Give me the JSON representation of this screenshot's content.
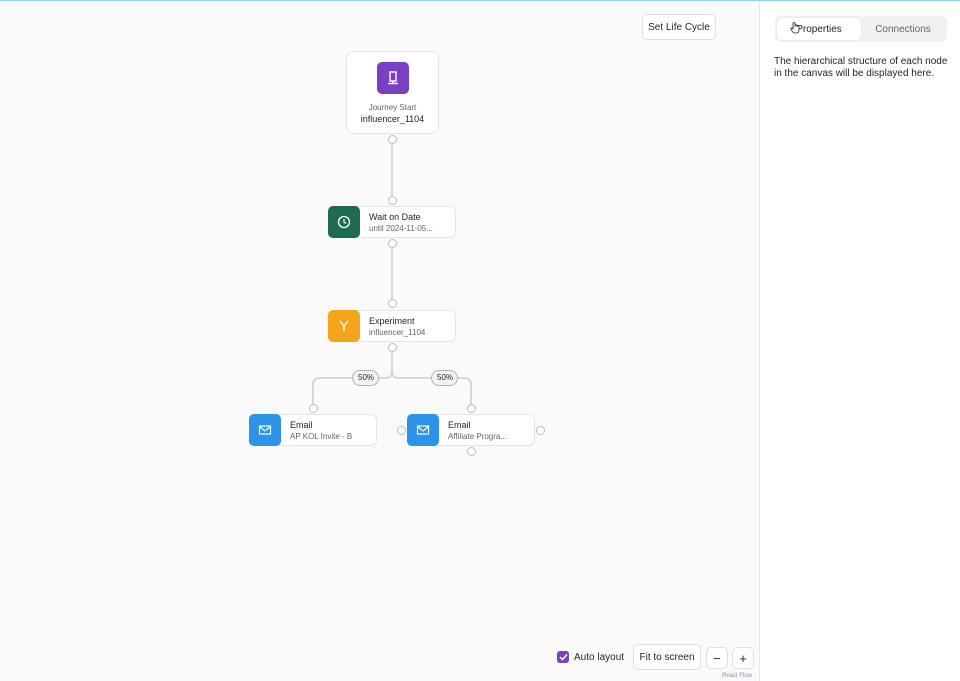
{
  "toolbar": {
    "set_life_cycle_label": "Set Life Cycle"
  },
  "nodes": {
    "start": {
      "title": "Journey Start",
      "subtitle": "influencer_1104",
      "icon": "flag-icon",
      "color": "#7b3fc4"
    },
    "wait": {
      "title": "Wait on Date",
      "subtitle": "until 2024-11-05...",
      "icon": "clock-icon",
      "color": "#1f6b52"
    },
    "experiment": {
      "title": "Experiment",
      "subtitle": "influencer_1104",
      "icon": "split-icon",
      "color": "#f4a51c"
    },
    "email_a": {
      "title": "Email",
      "subtitle": "AP KOL Invite - B",
      "icon": "mail-icon",
      "color": "#2b93e8"
    },
    "email_b": {
      "title": "Email",
      "subtitle": "Affiliate Progra...",
      "icon": "mail-icon",
      "color": "#2b93e8"
    }
  },
  "branches": {
    "left_percent": "50%",
    "right_percent": "50%"
  },
  "controls": {
    "auto_layout_label": "Auto layout",
    "auto_layout_checked": true,
    "fit_to_screen_label": "Fit to screen",
    "zoom_out_label": "−",
    "zoom_in_label": "+",
    "attribution": "React Flow"
  },
  "panel": {
    "tabs": [
      {
        "label": "Properties",
        "active": true
      },
      {
        "label": "Connections",
        "active": false
      }
    ],
    "description": "The hierarchical structure of each node in the canvas will be displayed here."
  }
}
